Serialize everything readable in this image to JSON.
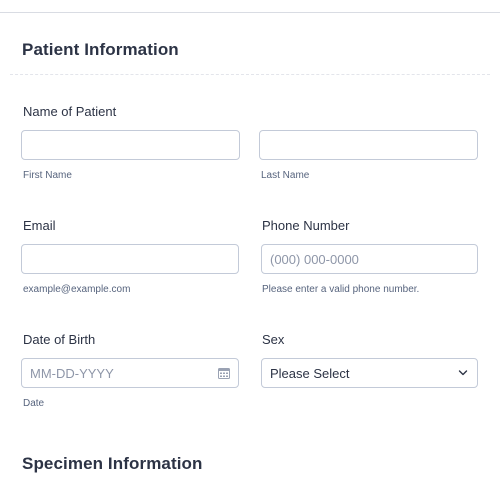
{
  "sections": {
    "patient_title": "Patient Information",
    "specimen_title": "Specimen Information"
  },
  "name": {
    "label": "Name of Patient",
    "first_sublabel": "First Name",
    "last_sublabel": "Last Name",
    "first_value": "",
    "last_value": ""
  },
  "email": {
    "label": "Email",
    "value": "",
    "sublabel": "example@example.com"
  },
  "phone": {
    "label": "Phone Number",
    "placeholder": "(000) 000-0000",
    "sublabel": "Please enter a valid phone number."
  },
  "dob": {
    "label": "Date of Birth",
    "placeholder": "MM-DD-YYYY",
    "sublabel": "Date",
    "icon": "calendar-icon"
  },
  "sex": {
    "label": "Sex",
    "selected": "Please Select",
    "icon": "chevron-down-icon"
  },
  "colors": {
    "text": "#2c3345",
    "border": "#c3cad8",
    "placeholder": "#8e96a8"
  }
}
